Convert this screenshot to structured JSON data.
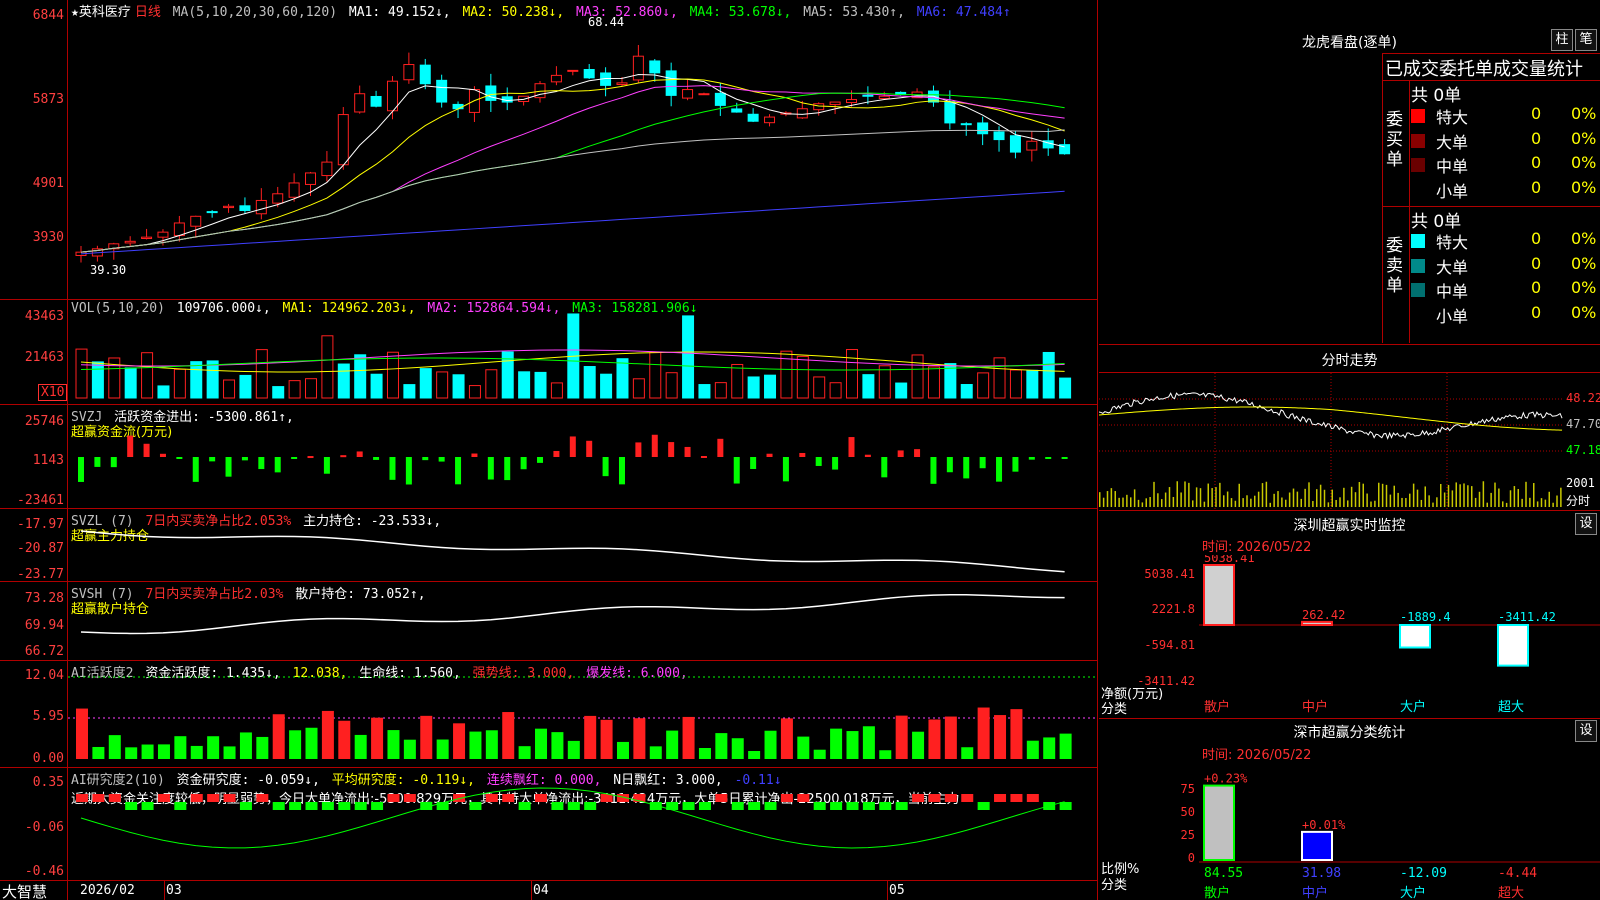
{
  "header": {
    "stock_name": "★英科医疗",
    "period": "日线",
    "ma_params": "MA(5,10,20,30,60,120)",
    "ma1": "MA1: 49.152↓,",
    "ma2": "MA2: 50.238↓,",
    "ma3": "MA3: 52.860↓,",
    "ma4": "MA4: 53.678↓,",
    "ma5": "MA5: 53.430↑,",
    "ma6": "MA6: 47.484↑",
    "high_label": "68.44",
    "low_label": "39.30",
    "colors": {
      "up": "#ff2020",
      "down": "#00ffff",
      "ma1": "#ffffff",
      "ma2": "#ffff00",
      "ma3": "#ff40ff",
      "ma4": "#00ff00",
      "ma5": "#c0c0c0",
      "ma6": "#4040ff"
    }
  },
  "price_axis": [
    "6844",
    "5873",
    "4901",
    "3930"
  ],
  "vol_panel": {
    "title": "VOL(5,10,20)",
    "v": "109706.000↓,",
    "ma1": "MA1: 124962.203↓,",
    "ma2": "MA2: 152864.594↓,",
    "ma3": "MA3: 158281.906↓",
    "axis": [
      "43463",
      "21463"
    ],
    "unit": "X10"
  },
  "svzj_panel": {
    "title": "SVZJ",
    "line": "活跃资金进出: -5300.861↑,",
    "subtitle": "超赢资金流(万元)",
    "axis": [
      "25746",
      "1143",
      "-23461"
    ]
  },
  "svzl_panel": {
    "title": "SVZL (7)",
    "part1": "7日内买卖净占比2.053%",
    "part2": "主力持仓: -23.533↓,",
    "subtitle": "超赢主力持仓",
    "axis": [
      "-17.97",
      "-20.87",
      "-23.77"
    ]
  },
  "svsh_panel": {
    "title": "SVSH (7)",
    "part1": "7日内买卖净占比2.03%",
    "part2": "散户持仓: 73.052↑,",
    "subtitle": "超赢散户持仓",
    "axis": [
      "73.28",
      "69.94",
      "66.72"
    ]
  },
  "ai_active_panel": {
    "title": "AI活跃度2",
    "p1": "资金活跃度: 1.435↓,",
    "p2": "12.038,",
    "p3": "生命线: 1.560,",
    "p4": "强势线: 3.000,",
    "p5": "爆发线: 6.000,",
    "axis": [
      "12.04",
      "5.95",
      "0.00"
    ]
  },
  "ai_research_panel": {
    "title": "AI研究度2(10)",
    "p1": "资金研究度: -0.059↓,",
    "p2": "平均研究度: -0.119↓,",
    "p3": "连续飘红: 0.000,",
    "p4": "N日飘红: 3.000,",
    "p5": "-0.11↓",
    "comment": "近期大资金关注度较低，明显弱势，今日大单净流出:-5300.829万元，其中特大单净流出:-3411.424万元，大单5日累计净出-22500.018万元，当前主力",
    "axis": [
      "0.35",
      "-0.06",
      "-0.46"
    ]
  },
  "bottom_axis": {
    "logo": "大智慧",
    "labels": [
      "2026/02",
      "03",
      "04",
      "05"
    ]
  },
  "dragon_tiger": {
    "title": "龙虎看盘(逐单)",
    "btn1": "柱",
    "btn2": "笔",
    "header": "已成交委托单成交量统计",
    "buy_label": "委买单",
    "sell_label": "委卖单",
    "buy_total": "共 0单",
    "sell_total": "共 0单",
    "buy_rows": [
      {
        "name": "特大",
        "count": "0",
        "pct": "0%"
      },
      {
        "name": "大单",
        "count": "0",
        "pct": "0%"
      },
      {
        "name": "中单",
        "count": "0",
        "pct": "0%"
      },
      {
        "name": "小单",
        "count": "0",
        "pct": "0%"
      }
    ],
    "sell_rows": [
      {
        "name": "特大",
        "count": "0",
        "pct": "0%"
      },
      {
        "name": "大单",
        "count": "0",
        "pct": "0%"
      },
      {
        "name": "中单",
        "count": "0",
        "pct": "0%"
      },
      {
        "name": "小单",
        "count": "0",
        "pct": "0%"
      }
    ],
    "buy_colors": [
      "#ff0000",
      "#8a0000",
      "#6a0000",
      "#000000"
    ],
    "sell_colors": [
      "#00ffff",
      "#008a8a",
      "#007070",
      "#000000"
    ]
  },
  "intraday": {
    "title": "分时走势",
    "axis": [
      "48.22",
      "47.70",
      "47.18"
    ],
    "vol_axis": [
      "2001",
      "分时"
    ]
  },
  "sz_monitor": {
    "title": "深圳超赢实时监控",
    "btn": "设",
    "time": "时间: 2026/05/22",
    "axis": [
      "5038.41",
      "2221.8",
      "-594.81",
      "-3411.42"
    ],
    "unit_label": "净额(万元)",
    "cat_label": "分类",
    "bars": [
      {
        "name": "散户",
        "value": 5038.41,
        "label": "5038.41"
      },
      {
        "name": "中户",
        "value": 262.42,
        "label": "262.42"
      },
      {
        "name": "大户",
        "value": -1889.4,
        "label": "-1889.4"
      },
      {
        "name": "超大",
        "value": -3411.42,
        "label": "-3411.42"
      }
    ]
  },
  "sz_class": {
    "title": "深市超赢分类统计",
    "btn": "设",
    "time": "时间: 2026/05/22",
    "axis": [
      "75",
      "50",
      "25",
      "0"
    ],
    "unit_label": "比例%",
    "cat_label": "分类",
    "bars": [
      {
        "name": "散户",
        "value": 84.55,
        "label": "84.55",
        "top": "+0.23%"
      },
      {
        "name": "中户",
        "value": 31.98,
        "label": "31.98",
        "top": "+0.01%"
      },
      {
        "name": "大户",
        "value": -12.09,
        "label": "-12.09",
        "top": ""
      },
      {
        "name": "超大",
        "value": -4.44,
        "label": "-4.44",
        "top": ""
      }
    ]
  }
}
